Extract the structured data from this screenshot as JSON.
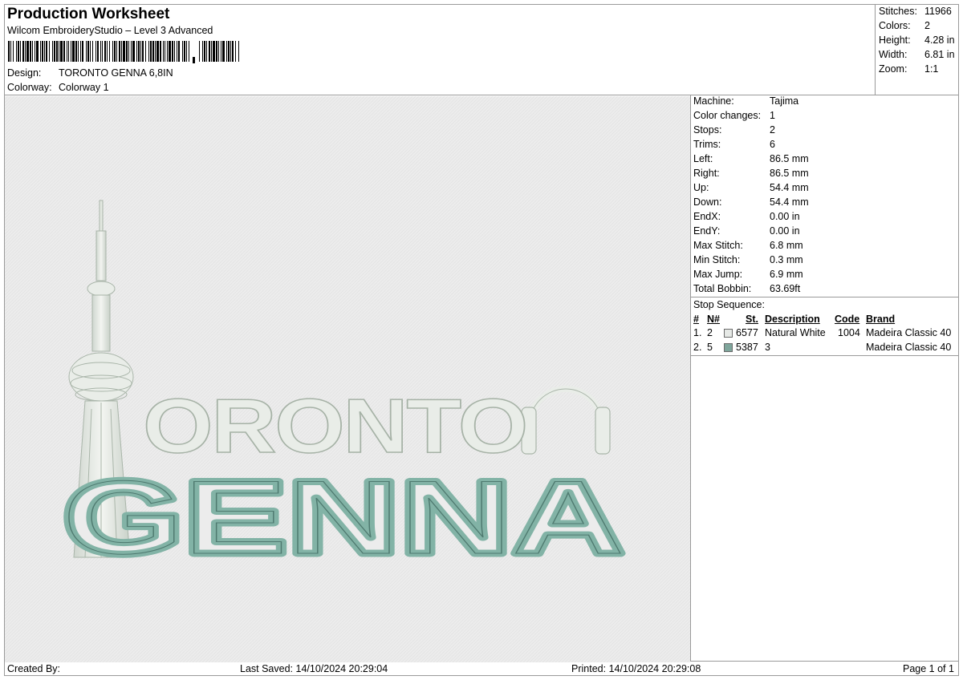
{
  "header": {
    "title": "Production Worksheet",
    "software": "Wilcom EmbroideryStudio – Level 3 Advanced",
    "design_label": "Design:",
    "design_value": "TORONTO GENNA 6,8IN",
    "colorway_label": "Colorway:",
    "colorway_value": "Colorway 1"
  },
  "summary": {
    "stitches_label": "Stitches:",
    "stitches_value": "11966",
    "colors_label": "Colors:",
    "colors_value": "2",
    "height_label": "Height:",
    "height_value": "4.28 in",
    "width_label": "Width:",
    "width_value": "6.81 in",
    "zoom_label": "Zoom:",
    "zoom_value": "1:1"
  },
  "machine_info": {
    "rows": [
      {
        "label": "Machine:",
        "value": "Tajima"
      },
      {
        "label": "Color changes:",
        "value": "1"
      },
      {
        "label": "Stops:",
        "value": "2"
      },
      {
        "label": "Trims:",
        "value": "6"
      },
      {
        "label": "Left:",
        "value": "86.5 mm"
      },
      {
        "label": "Right:",
        "value": "86.5 mm"
      },
      {
        "label": "Up:",
        "value": "54.4 mm"
      },
      {
        "label": "Down:",
        "value": "54.4 mm"
      },
      {
        "label": "EndX:",
        "value": "0.00 in"
      },
      {
        "label": "EndY:",
        "value": "0.00 in"
      },
      {
        "label": "Max Stitch:",
        "value": "6.8 mm"
      },
      {
        "label": "Min Stitch:",
        "value": "0.3 mm"
      },
      {
        "label": "Max Jump:",
        "value": "6.9 mm"
      },
      {
        "label": "Total Bobbin:",
        "value": "63.69ft"
      }
    ]
  },
  "stop_sequence": {
    "title": "Stop Sequence:",
    "columns": {
      "hash": "#",
      "n": "N#",
      "st": "St.",
      "description": "Description",
      "code": "Code",
      "brand": "Brand"
    },
    "rows": [
      {
        "hash": "1.",
        "n": "2",
        "swatch_color": "#e6e9e6",
        "st": "6577",
        "description": "Natural White",
        "code": "1004",
        "brand": "Madeira Classic 40"
      },
      {
        "hash": "2.",
        "n": "5",
        "swatch_color": "#7fa69c",
        "st": "5387",
        "description": "3",
        "code": "",
        "brand": "Madeira Classic 40"
      }
    ]
  },
  "design_preview": {
    "line1": "ORONTO",
    "line2": "GENNA",
    "thread_colors": {
      "white": "#e9ede8",
      "teal": "#82b3a6"
    }
  },
  "footer": {
    "created_by_label": "Created By:",
    "last_saved_label": "Last Saved:",
    "last_saved_value": "14/10/2024 20:29:04",
    "printed_label": "Printed:",
    "printed_value": "14/10/2024 20:29:08",
    "page_label": "Page 1 of 1"
  }
}
